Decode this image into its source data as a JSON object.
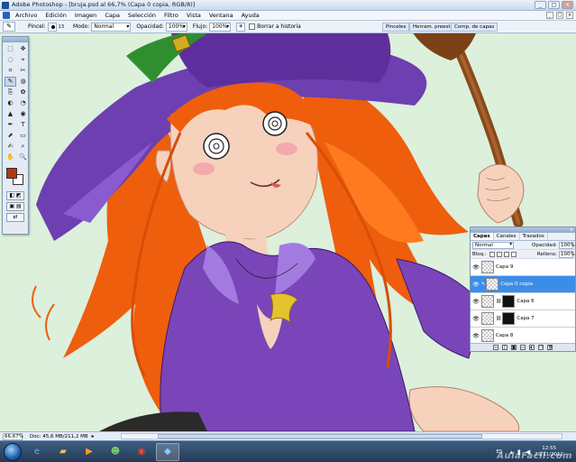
{
  "window": {
    "title": "Adobe Photoshop - [bruja.psd al 66,7% (Capa 0 copia, RGB/8)]",
    "buttons": [
      "_",
      "□",
      "×"
    ]
  },
  "menu": {
    "items": [
      "Archivo",
      "Edición",
      "Imagen",
      "Capa",
      "Selección",
      "Filtro",
      "Vista",
      "Ventana",
      "Ayuda"
    ]
  },
  "options": {
    "tool_icon": "brush-icon",
    "brush_label": "Pincel:",
    "brush_size": "13",
    "mode_label": "Modo:",
    "mode_value": "Normal",
    "opacity_label": "Opacidad:",
    "opacity_value": "100%",
    "flow_label": "Flujo:",
    "flow_value": "100%",
    "history_label": "Borrar a historia",
    "palette_wells": [
      "Pinceles",
      "Herram. preest.",
      "Comp. de capas"
    ]
  },
  "toolbox": {
    "tools": [
      "⬚",
      "✥",
      "◌",
      "⌖",
      "⌗",
      "✂",
      "✎",
      "◍",
      "⎘",
      "✿",
      "◐",
      "◔",
      "▲",
      "◉",
      "✒",
      "T",
      "⬈",
      "▭",
      "✍",
      "⌕",
      "✋",
      "🔍"
    ],
    "foreground_color": "#b03a16",
    "background_color": "#ffffff"
  },
  "layers_panel": {
    "tabs": [
      "Capas",
      "Canales",
      "Trazados"
    ],
    "blend_mode": "Normal",
    "opacity_label": "Opacidad:",
    "opacity_value": "100%",
    "lock_label": "Bloq.:",
    "fill_label": "Relleno:",
    "fill_value": "100%",
    "layers": [
      {
        "name": "Capa 9",
        "active": false,
        "mask": false
      },
      {
        "name": "Capa 0 copia",
        "active": true,
        "mask": false
      },
      {
        "name": "Capa 6",
        "active": false,
        "mask": true
      },
      {
        "name": "Capa 7",
        "active": false,
        "mask": true
      },
      {
        "name": "Capa 8",
        "active": false,
        "mask": false
      }
    ]
  },
  "status": {
    "zoom": "66,67%",
    "doc": "Doc: 45,6 MB/211,2 MB"
  },
  "taskbar": {
    "language": "ES",
    "time": "12:55",
    "date": "23/11/2012",
    "watermark": "AulaFacil.com"
  },
  "colors": {
    "canvas_bg": "#dcf0dc",
    "hair": "#f0640f",
    "hat": "#6d3fb0",
    "shirt": "#7a45b8",
    "skin": "#f6d2bd",
    "selected_layer": "#3b8ee8"
  }
}
